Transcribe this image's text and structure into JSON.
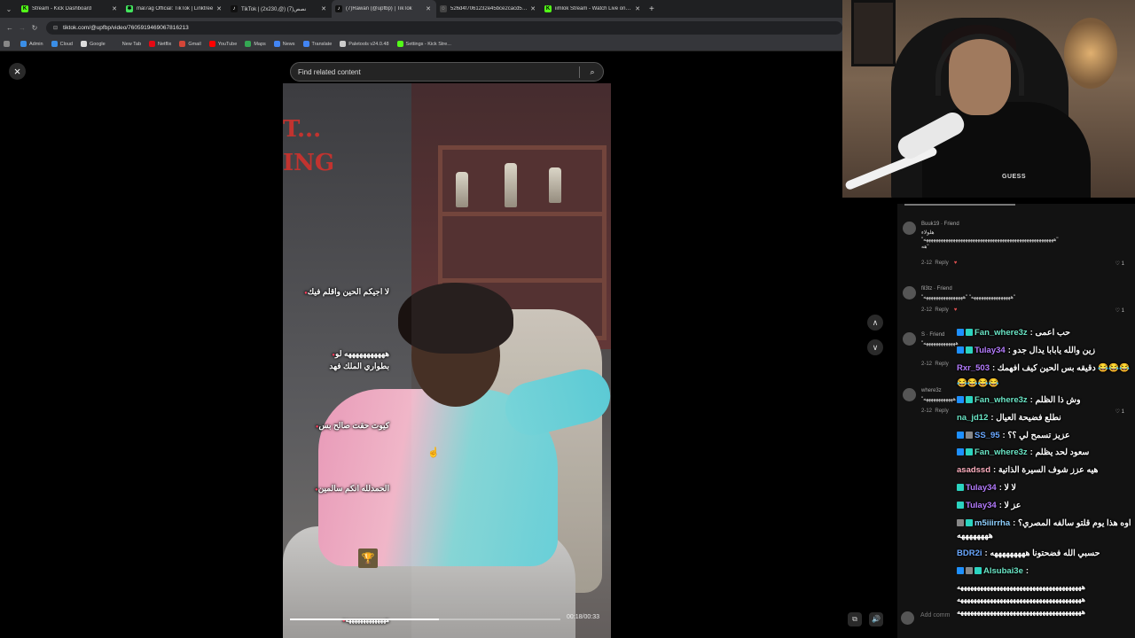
{
  "browser": {
    "tabs": [
      {
        "title": "Stream - Kick Dashboard",
        "favicon_color": "#53fc18",
        "favicon_glyph": "K"
      },
      {
        "title": "mal7ag Official: TikTok | Linktree",
        "favicon_color": "#43e55e",
        "favicon_glyph": "✱"
      },
      {
        "title": "TikTok | (2x230,@) نصص(7)",
        "favicon_color": "#111111",
        "favicon_glyph": "♪"
      },
      {
        "title": "(7)Rawan (@upfbp) | TikTok",
        "favicon_color": "#111111",
        "favicon_glyph": "♪",
        "active": true
      },
      {
        "title": "526d4f7061232e45bce2cacd531…",
        "favicon_color": "#444444",
        "favicon_glyph": "◌"
      },
      {
        "title": "iimlok Stream - Watch Live on…",
        "favicon_color": "#53fc18",
        "favicon_glyph": "K"
      }
    ],
    "url": "tiktok.com/@upfbp/video/7605919469067816213",
    "bookmarks": [
      {
        "label": "Admin",
        "color": "#3a8ee6"
      },
      {
        "label": "Cloud",
        "color": "#3a8ee6"
      },
      {
        "label": "Google",
        "color": "#dddddd"
      },
      {
        "label": "New Tab",
        "color": "#35363a"
      },
      {
        "label": "Netflix",
        "color": "#e50914"
      },
      {
        "label": "Gmail",
        "color": "#d44638"
      },
      {
        "label": "YouTube",
        "color": "#ff0000"
      },
      {
        "label": "Maps",
        "color": "#34a853"
      },
      {
        "label": "News",
        "color": "#4285f4"
      },
      {
        "label": "Translate",
        "color": "#4285f4"
      },
      {
        "label": "Paletools v24.0.48",
        "color": "#cccccc"
      },
      {
        "label": "Settings - Kick Stre...",
        "color": "#53fc18"
      }
    ]
  },
  "viewer": {
    "search_placeholder": "Find related content",
    "video_title_fragment_1": "T...",
    "video_title_fragment_2": "ING",
    "captions": [
      "لا اجيكم الحين واقلم فيك",
      "هههههههههههه لو",
      "بطواري الملك فهد",
      "كيوت حقت صالح بس",
      "الحمدلله انكم سالمين",
      "ههههههههههههههه"
    ],
    "time": "00:18/00:33",
    "progress": 0.55
  },
  "comments": [
    {
      "user": "Buuk19 · Friend",
      "text": "هلولاء",
      "text2": "\"هههههههههههههههههههههههههههههههههههههههههههههههههههههه\"",
      "text3": "هه\"",
      "date": "2-12",
      "reply": "Reply",
      "likes": "1"
    },
    {
      "user": "fil3tz · Friend",
      "text": "\"ههههههههههههههههه\" \"ههههههههههههههههه\"",
      "date": "2-12",
      "reply": "Reply",
      "likes": "1"
    },
    {
      "user": "S · Friend",
      "text": "\"هههههههههههههه",
      "date": "2-12",
      "reply": "Reply",
      "likes": ""
    },
    {
      "user": "where3z",
      "text": "\"ههههههههههههه",
      "date": "2-12",
      "reply": "Reply",
      "likes": "1"
    }
  ],
  "comment_input_placeholder": "Add comm",
  "webcam": {
    "brand": "GUESS"
  },
  "chat": [
    {
      "user": "Fan_where3z",
      "color": "#6be6c6",
      "body": "حب اعمى",
      "badges": [
        "#1e90ff",
        "#2bd4c0"
      ]
    },
    {
      "user": "Tulay34",
      "color": "#b57cff",
      "body": "زين والله يابابا يدال جدو",
      "badges": [
        "#1e90ff",
        "#2bd4c0"
      ]
    },
    {
      "user": "Rxr_503",
      "color": "#b57cff",
      "body": "دقيقه بس الحين كيف افهمك",
      "emotes": "😂😂😂",
      "badges": []
    },
    {
      "user": "",
      "color": "#ffffff",
      "body": "",
      "emotes": "😂😂😂😂",
      "badges": []
    },
    {
      "user": "Fan_where3z",
      "color": "#6be6c6",
      "body": "وش ذا الظلم",
      "badges": [
        "#1e90ff",
        "#2bd4c0"
      ]
    },
    {
      "user": "na_jd12",
      "color": "#6be6c6",
      "body": "نطلع فضيحة العيال",
      "badges": []
    },
    {
      "user": "SS_95",
      "color": "#6aa8ff",
      "body": "عزيز تسمح لي ؟؟",
      "badges": [
        "#1e90ff",
        "#888888"
      ]
    },
    {
      "user": "Fan_where3z",
      "color": "#6be6c6",
      "body": "سعود لحد يظلم",
      "badges": [
        "#1e90ff",
        "#2bd4c0"
      ]
    },
    {
      "user": "asadssd",
      "color": "#ffb0c0",
      "body": "هيه عزز شوف السيرة الذاتية",
      "badges": []
    },
    {
      "user": "Tulay34",
      "color": "#b57cff",
      "body": "لا لا",
      "badges": [
        "#2bd4c0"
      ]
    },
    {
      "user": "Tulay34",
      "color": "#b57cff",
      "body": "عز لا",
      "badges": [
        "#2bd4c0"
      ]
    },
    {
      "user": "m5iiirrha",
      "color": "#8fd0ff",
      "body": "اوه هذا يوم قلتو سالفه المصري؟",
      "badges": [
        "#888888",
        "#2bd4c0"
      ]
    },
    {
      "user": "",
      "color": "#ffffff",
      "body": "ههههههههه",
      "badges": []
    },
    {
      "user": "BDR2i",
      "color": "#6aa8ff",
      "body": "حسبي الله فضحتونا هههههههههه",
      "badges": []
    },
    {
      "user": "Alsubai3e",
      "color": "#6be6c6",
      "body": "",
      "badges": [
        "#1e90ff",
        "#888888",
        "#2bd4c0"
      ]
    },
    {
      "user": "",
      "color": "#ffffff",
      "body": "ههههههههههههههههههههههههههههههههههههههه",
      "badges": []
    },
    {
      "user": "",
      "color": "#ffffff",
      "body": "ههههههههههههههههههههههههههههههههههههههه",
      "badges": []
    },
    {
      "user": "",
      "color": "#ffffff",
      "body": "ههههههههههههههههههههههههههههههههههههههه",
      "badges": []
    }
  ]
}
